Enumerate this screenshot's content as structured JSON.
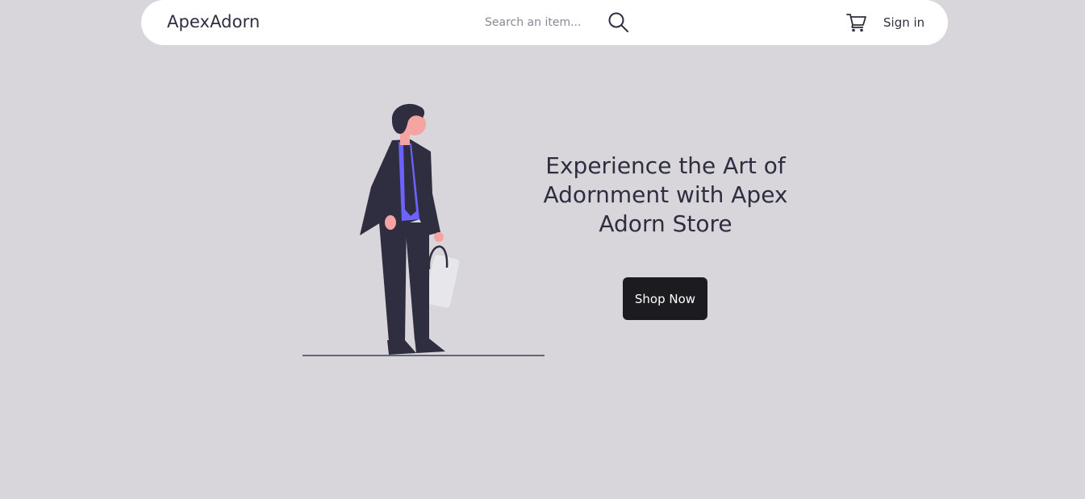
{
  "navbar": {
    "brand": "ApexAdorn",
    "search": {
      "placeholder": "Search an item...",
      "value": ""
    },
    "search_icon": "search-icon",
    "cart_icon": "cart-icon",
    "signin_label": "Sign in"
  },
  "hero": {
    "title": "Experience the Art of Adornment with Apex Adorn Store",
    "button_label": "Shop Now",
    "illustration": "person-with-shopping-bag"
  },
  "colors": {
    "background": "#d8d6db",
    "navbar": "#ffffff",
    "text": "#2f2e41",
    "button": "#1c1b20",
    "accent": "#6c63ff",
    "skin": "#f5a4a2"
  }
}
